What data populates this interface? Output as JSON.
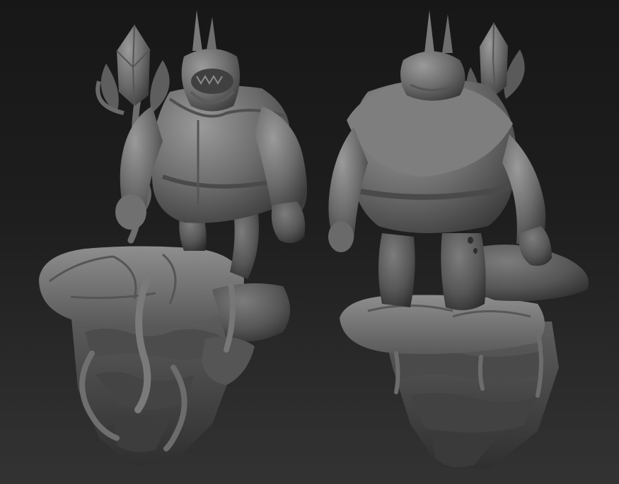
{
  "scene": {
    "background_top": "#171717",
    "background_bottom": "#333333",
    "clay_light": "#8a8a8a",
    "clay_mid": "#6a6a6a",
    "clay_dark": "#3a3a3a",
    "views": [
      {
        "name": "front-three-quarter-view"
      },
      {
        "name": "back-three-quarter-view"
      }
    ]
  }
}
